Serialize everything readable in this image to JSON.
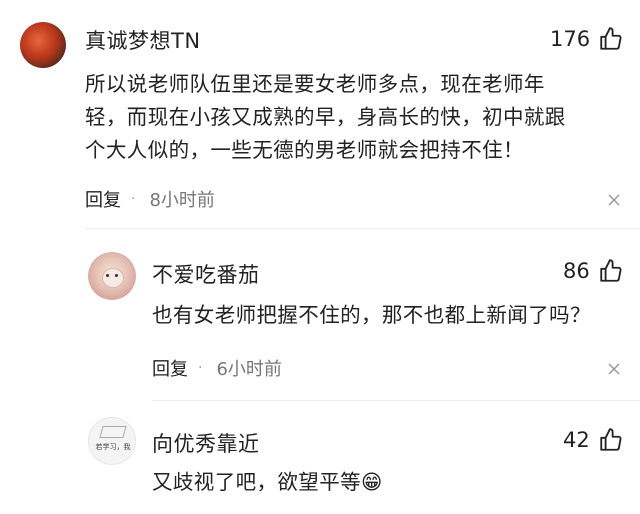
{
  "comments": [
    {
      "username": "真诚梦想TN",
      "likes": "176",
      "lines": [
        "所以说老师队伍里还是要女老师多点，现在老师年",
        "轻，而现在小孩又成熟的早，身高长的快，初中就跟",
        "个大人似的，一些无德的男老师就会把持不住！"
      ],
      "reply_label": "回复",
      "time": "8小时前"
    },
    {
      "username": "不爱吃番茄",
      "likes": "86",
      "lines": [
        "也有女老师把握不住的，那不也都上新闻了吗？"
      ],
      "reply_label": "回复",
      "time": "6小时前"
    },
    {
      "username": "向优秀靠近",
      "likes": "42",
      "lines": [
        "又歧视了吧，欲望平等😁"
      ],
      "avatar_text": "若学习，我"
    }
  ],
  "icons": {
    "like": "thumbs-up-icon",
    "dismiss": "close-icon"
  }
}
